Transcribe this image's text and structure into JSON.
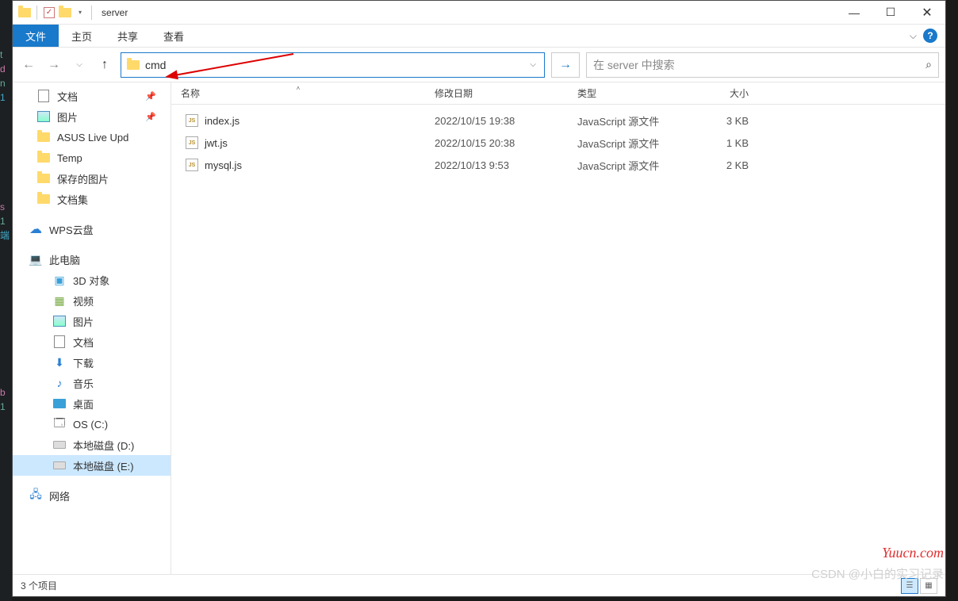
{
  "window": {
    "title": "server"
  },
  "ribbon": {
    "file": "文件",
    "home": "主页",
    "share": "共享",
    "view": "查看"
  },
  "address": {
    "value": "cmd"
  },
  "search": {
    "placeholder": "在 server 中搜索"
  },
  "columns": {
    "name": "名称",
    "date": "修改日期",
    "type": "类型",
    "size": "大小"
  },
  "nav": {
    "documents": "文档",
    "pictures": "图片",
    "asus": "ASUS Live Upd",
    "temp": "Temp",
    "saved_pictures": "保存的图片",
    "doc_set": "文档集",
    "wps": "WPS云盘",
    "this_pc": "此电脑",
    "objects3d": "3D 对象",
    "videos": "视频",
    "pictures2": "图片",
    "documents2": "文档",
    "downloads": "下载",
    "music": "音乐",
    "desktop": "桌面",
    "os_c": "OS (C:)",
    "disk_d": "本地磁盘 (D:)",
    "disk_e": "本地磁盘 (E:)",
    "network": "网络"
  },
  "files": [
    {
      "name": "index.js",
      "date": "2022/10/15 19:38",
      "type": "JavaScript 源文件",
      "size": "3 KB"
    },
    {
      "name": "jwt.js",
      "date": "2022/10/15 20:38",
      "type": "JavaScript 源文件",
      "size": "1 KB"
    },
    {
      "name": "mysql.js",
      "date": "2022/10/13 9:53",
      "type": "JavaScript 源文件",
      "size": "2 KB"
    }
  ],
  "status": {
    "item_count": "3 个项目"
  },
  "watermarks": {
    "w1": "Yuucn.com",
    "w2": "CSDN @小白的实习记录"
  }
}
